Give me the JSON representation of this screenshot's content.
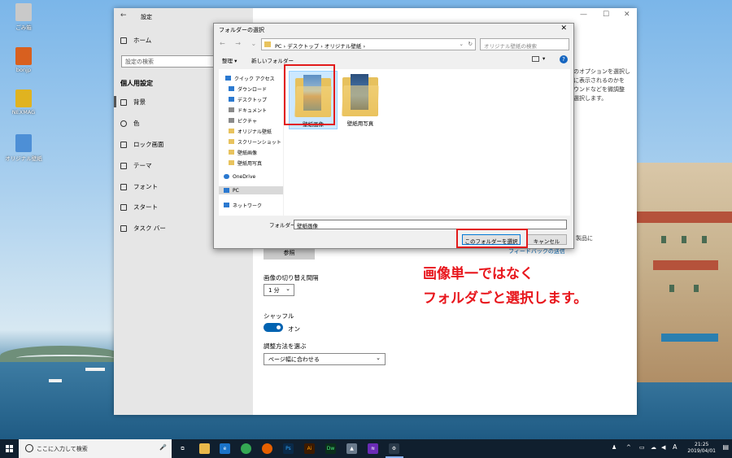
{
  "desktop": {
    "icons": [
      {
        "label": "ごみ箱",
        "color": "#c9c9c9"
      },
      {
        "label": "bonjp",
        "color": "#d8601f"
      },
      {
        "label": "NEXMAG",
        "color": "#e0b320"
      },
      {
        "label": "オリジナル壁紙",
        "color": "#4d8fd6"
      }
    ]
  },
  "settings": {
    "title": "設定",
    "home_label": "ホーム",
    "search_placeholder": "設定の検索",
    "section_title": "個人用設定",
    "nav": [
      "背景",
      "色",
      "ロック画面",
      "テーマ",
      "フォント",
      "スタート",
      "タスク バー"
    ],
    "right_text": [
      "のオプションを選択し",
      "に表示されるのかを",
      "ウンドなどを微調整",
      "選択します。"
    ],
    "right_text2": "製品に",
    "link_text": "フィードバックの送信",
    "browse_label": "参照",
    "interval_label": "画像の切り替え間隔",
    "interval_value": "1 分",
    "shuffle_label": "シャッフル",
    "shuffle_state": "オン",
    "fit_label": "調整方法を選ぶ",
    "fit_value": "ページ幅に合わせる"
  },
  "dialog": {
    "title": "フォルダーの選択",
    "breadcrumb": "PC  ›  デスクトップ  ›  オリジナル壁紙  ›",
    "search_placeholder": "オリジナル壁紙の検索",
    "organize_label": "整理 ▾",
    "new_folder_label": "新しいフォルダー",
    "tree": [
      {
        "label": "クイック アクセス",
        "color": "#2b79d0"
      },
      {
        "label": "ダウンロード",
        "color": "#2b79d0"
      },
      {
        "label": "デスクトップ",
        "color": "#2b79d0"
      },
      {
        "label": "ドキュメント",
        "color": "#8a8a8a"
      },
      {
        "label": "ピクチャ",
        "color": "#8a8a8a"
      },
      {
        "label": "オリジナル壁紙",
        "color": "#e8c35e"
      },
      {
        "label": "スクリーンショット",
        "color": "#e8c35e"
      },
      {
        "label": "壁紙画像",
        "color": "#e8c35e"
      },
      {
        "label": "壁紙用写真",
        "color": "#e8c35e"
      },
      {
        "label": "OneDrive",
        "color": "#2b79d0"
      },
      {
        "label": "PC",
        "color": "#2b79d0"
      },
      {
        "label": "ネットワーク",
        "color": "#2b79d0"
      }
    ],
    "folders": [
      "壁紙画像",
      "壁紙用写真"
    ],
    "folder_field_label": "フォルダー:",
    "folder_field_value": "壁紙画像",
    "select_button": "このフォルダーを選択",
    "cancel_button": "キャンセル"
  },
  "annotation": {
    "line1": "画像単一ではなく",
    "line2": "フォルダごと選択します。"
  },
  "taskbar": {
    "search_placeholder": "ここに入力して検索",
    "apps": [
      {
        "name": "task-view",
        "color": "#101f2e",
        "text": "⧉"
      },
      {
        "name": "file-explorer",
        "color": "#e8b84a",
        "text": ""
      },
      {
        "name": "edge",
        "color": "#1a73c8",
        "text": "e"
      },
      {
        "name": "chrome",
        "color": "#34a853",
        "text": "●"
      },
      {
        "name": "firefox",
        "color": "#e66000",
        "text": "●"
      },
      {
        "name": "photoshop",
        "color": "#0a2a49",
        "text": "Ps"
      },
      {
        "name": "illustrator",
        "color": "#3c1a00",
        "text": "Ai"
      },
      {
        "name": "dreamweaver",
        "color": "#0b2f1b",
        "text": "Dw"
      },
      {
        "name": "photos",
        "color": "#6a7b8c",
        "text": "▲"
      },
      {
        "name": "premiere",
        "color": "#6a2bb5",
        "text": "≋"
      },
      {
        "name": "settings",
        "color": "#2a3a4a",
        "text": "⚙"
      }
    ],
    "ime": "A",
    "time": "21:25",
    "date": "2019/04/01"
  }
}
